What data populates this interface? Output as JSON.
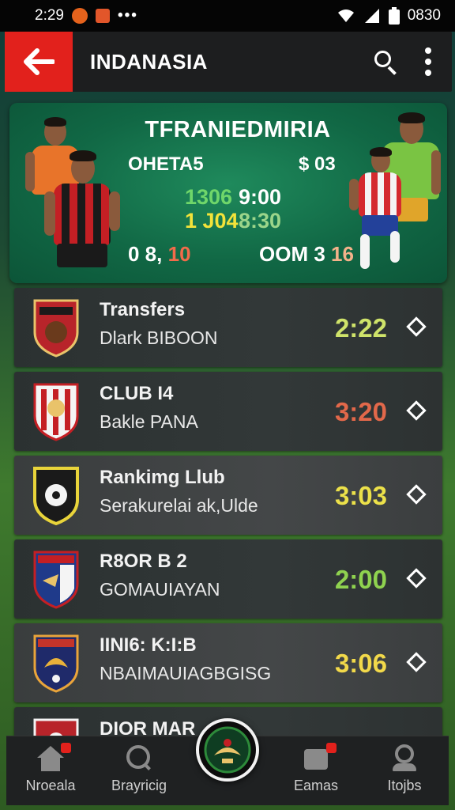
{
  "status_bar": {
    "time": "2:29",
    "clock_right": "0830"
  },
  "app_bar": {
    "title": "INDANASIA"
  },
  "hero": {
    "title": "TFRANIEDMIRIA",
    "left_label": "OHETA5",
    "right_label": "$ 03",
    "score_a": "1306",
    "time_a": "9:00",
    "score_b": "1 J04",
    "time_b": "8:30",
    "bottom_left_main": "0 8,",
    "bottom_left_accent": "10",
    "bottom_right_main": "OOM 3",
    "bottom_right_accent": "16"
  },
  "matches": [
    {
      "title": "Transfers",
      "subtitle": "Dlark BIBOON",
      "time": "2:22",
      "time_color": "#cfe36a"
    },
    {
      "title": "CLUB I4",
      "subtitle": "Bakle PANA",
      "time": "3:20",
      "time_color": "#e2684a"
    },
    {
      "title": "Rankimg Llub",
      "subtitle": "Serakurelai ak,Ulde",
      "time": "3:03",
      "time_color": "#ece14a"
    },
    {
      "title": "R8OR B 2",
      "subtitle": "GOMAUIAYAN",
      "time": "2:00",
      "time_color": "#8fd24f"
    },
    {
      "title": "IINI6: K:I:B",
      "subtitle": "NBAIMAUIAGBGISG",
      "time": "3:06",
      "time_color": "#f2d94a"
    },
    {
      "title": "DIOR MAR",
      "subtitle": "",
      "time": "",
      "time_color": "#cfe36a"
    }
  ],
  "bottom_nav": {
    "items": [
      {
        "label": "Nroeala"
      },
      {
        "label": "Brayricig"
      },
      {
        "label": "Eamas"
      },
      {
        "label": "Itojbs"
      }
    ]
  },
  "colors": {
    "accent_red": "#e2211c",
    "hero_green": "#116845"
  }
}
